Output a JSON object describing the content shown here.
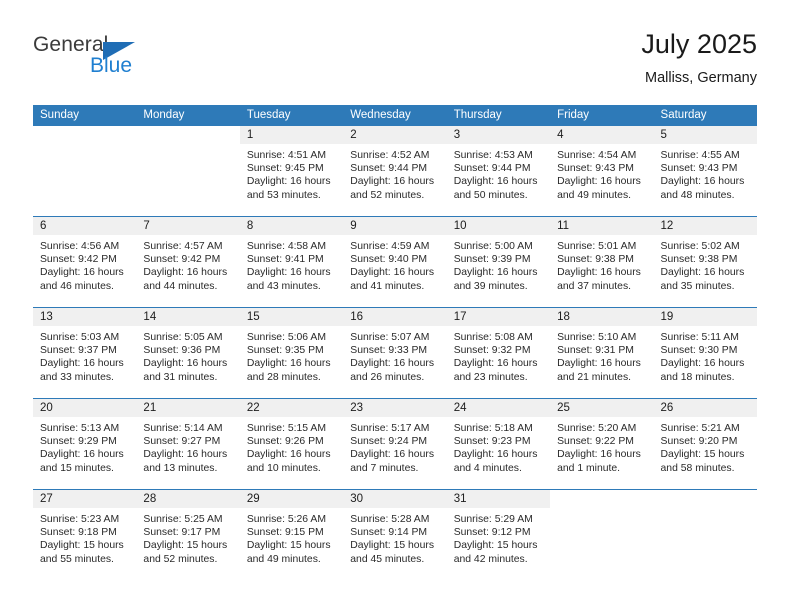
{
  "brand": {
    "name_part1": "General",
    "name_part2": "Blue",
    "flag_color": "#1f6db5",
    "text_color": "#1f7fd0"
  },
  "header": {
    "title": "July 2025",
    "location": "Malliss, Germany"
  },
  "calendar": {
    "accent_color": "#2e7ab8",
    "daynum_bg": "#f0f0f0",
    "weekday_headers": [
      "Sunday",
      "Monday",
      "Tuesday",
      "Wednesday",
      "Thursday",
      "Friday",
      "Saturday"
    ],
    "weeks": [
      [
        {
          "day": "",
          "sunrise": "",
          "sunset": "",
          "daylight": "",
          "blank": true
        },
        {
          "day": "",
          "sunrise": "",
          "sunset": "",
          "daylight": "",
          "blank": true
        },
        {
          "day": "1",
          "sunrise": "Sunrise: 4:51 AM",
          "sunset": "Sunset: 9:45 PM",
          "daylight": "Daylight: 16 hours and 53 minutes."
        },
        {
          "day": "2",
          "sunrise": "Sunrise: 4:52 AM",
          "sunset": "Sunset: 9:44 PM",
          "daylight": "Daylight: 16 hours and 52 minutes."
        },
        {
          "day": "3",
          "sunrise": "Sunrise: 4:53 AM",
          "sunset": "Sunset: 9:44 PM",
          "daylight": "Daylight: 16 hours and 50 minutes."
        },
        {
          "day": "4",
          "sunrise": "Sunrise: 4:54 AM",
          "sunset": "Sunset: 9:43 PM",
          "daylight": "Daylight: 16 hours and 49 minutes."
        },
        {
          "day": "5",
          "sunrise": "Sunrise: 4:55 AM",
          "sunset": "Sunset: 9:43 PM",
          "daylight": "Daylight: 16 hours and 48 minutes."
        }
      ],
      [
        {
          "day": "6",
          "sunrise": "Sunrise: 4:56 AM",
          "sunset": "Sunset: 9:42 PM",
          "daylight": "Daylight: 16 hours and 46 minutes."
        },
        {
          "day": "7",
          "sunrise": "Sunrise: 4:57 AM",
          "sunset": "Sunset: 9:42 PM",
          "daylight": "Daylight: 16 hours and 44 minutes."
        },
        {
          "day": "8",
          "sunrise": "Sunrise: 4:58 AM",
          "sunset": "Sunset: 9:41 PM",
          "daylight": "Daylight: 16 hours and 43 minutes."
        },
        {
          "day": "9",
          "sunrise": "Sunrise: 4:59 AM",
          "sunset": "Sunset: 9:40 PM",
          "daylight": "Daylight: 16 hours and 41 minutes."
        },
        {
          "day": "10",
          "sunrise": "Sunrise: 5:00 AM",
          "sunset": "Sunset: 9:39 PM",
          "daylight": "Daylight: 16 hours and 39 minutes."
        },
        {
          "day": "11",
          "sunrise": "Sunrise: 5:01 AM",
          "sunset": "Sunset: 9:38 PM",
          "daylight": "Daylight: 16 hours and 37 minutes."
        },
        {
          "day": "12",
          "sunrise": "Sunrise: 5:02 AM",
          "sunset": "Sunset: 9:38 PM",
          "daylight": "Daylight: 16 hours and 35 minutes."
        }
      ],
      [
        {
          "day": "13",
          "sunrise": "Sunrise: 5:03 AM",
          "sunset": "Sunset: 9:37 PM",
          "daylight": "Daylight: 16 hours and 33 minutes."
        },
        {
          "day": "14",
          "sunrise": "Sunrise: 5:05 AM",
          "sunset": "Sunset: 9:36 PM",
          "daylight": "Daylight: 16 hours and 31 minutes."
        },
        {
          "day": "15",
          "sunrise": "Sunrise: 5:06 AM",
          "sunset": "Sunset: 9:35 PM",
          "daylight": "Daylight: 16 hours and 28 minutes."
        },
        {
          "day": "16",
          "sunrise": "Sunrise: 5:07 AM",
          "sunset": "Sunset: 9:33 PM",
          "daylight": "Daylight: 16 hours and 26 minutes."
        },
        {
          "day": "17",
          "sunrise": "Sunrise: 5:08 AM",
          "sunset": "Sunset: 9:32 PM",
          "daylight": "Daylight: 16 hours and 23 minutes."
        },
        {
          "day": "18",
          "sunrise": "Sunrise: 5:10 AM",
          "sunset": "Sunset: 9:31 PM",
          "daylight": "Daylight: 16 hours and 21 minutes."
        },
        {
          "day": "19",
          "sunrise": "Sunrise: 5:11 AM",
          "sunset": "Sunset: 9:30 PM",
          "daylight": "Daylight: 16 hours and 18 minutes."
        }
      ],
      [
        {
          "day": "20",
          "sunrise": "Sunrise: 5:13 AM",
          "sunset": "Sunset: 9:29 PM",
          "daylight": "Daylight: 16 hours and 15 minutes."
        },
        {
          "day": "21",
          "sunrise": "Sunrise: 5:14 AM",
          "sunset": "Sunset: 9:27 PM",
          "daylight": "Daylight: 16 hours and 13 minutes."
        },
        {
          "day": "22",
          "sunrise": "Sunrise: 5:15 AM",
          "sunset": "Sunset: 9:26 PM",
          "daylight": "Daylight: 16 hours and 10 minutes."
        },
        {
          "day": "23",
          "sunrise": "Sunrise: 5:17 AM",
          "sunset": "Sunset: 9:24 PM",
          "daylight": "Daylight: 16 hours and 7 minutes."
        },
        {
          "day": "24",
          "sunrise": "Sunrise: 5:18 AM",
          "sunset": "Sunset: 9:23 PM",
          "daylight": "Daylight: 16 hours and 4 minutes."
        },
        {
          "day": "25",
          "sunrise": "Sunrise: 5:20 AM",
          "sunset": "Sunset: 9:22 PM",
          "daylight": "Daylight: 16 hours and 1 minute."
        },
        {
          "day": "26",
          "sunrise": "Sunrise: 5:21 AM",
          "sunset": "Sunset: 9:20 PM",
          "daylight": "Daylight: 15 hours and 58 minutes."
        }
      ],
      [
        {
          "day": "27",
          "sunrise": "Sunrise: 5:23 AM",
          "sunset": "Sunset: 9:18 PM",
          "daylight": "Daylight: 15 hours and 55 minutes."
        },
        {
          "day": "28",
          "sunrise": "Sunrise: 5:25 AM",
          "sunset": "Sunset: 9:17 PM",
          "daylight": "Daylight: 15 hours and 52 minutes."
        },
        {
          "day": "29",
          "sunrise": "Sunrise: 5:26 AM",
          "sunset": "Sunset: 9:15 PM",
          "daylight": "Daylight: 15 hours and 49 minutes."
        },
        {
          "day": "30",
          "sunrise": "Sunrise: 5:28 AM",
          "sunset": "Sunset: 9:14 PM",
          "daylight": "Daylight: 15 hours and 45 minutes."
        },
        {
          "day": "31",
          "sunrise": "Sunrise: 5:29 AM",
          "sunset": "Sunset: 9:12 PM",
          "daylight": "Daylight: 15 hours and 42 minutes."
        },
        {
          "day": "",
          "sunrise": "",
          "sunset": "",
          "daylight": "",
          "blank": true
        },
        {
          "day": "",
          "sunrise": "",
          "sunset": "",
          "daylight": "",
          "blank": true
        }
      ]
    ]
  }
}
